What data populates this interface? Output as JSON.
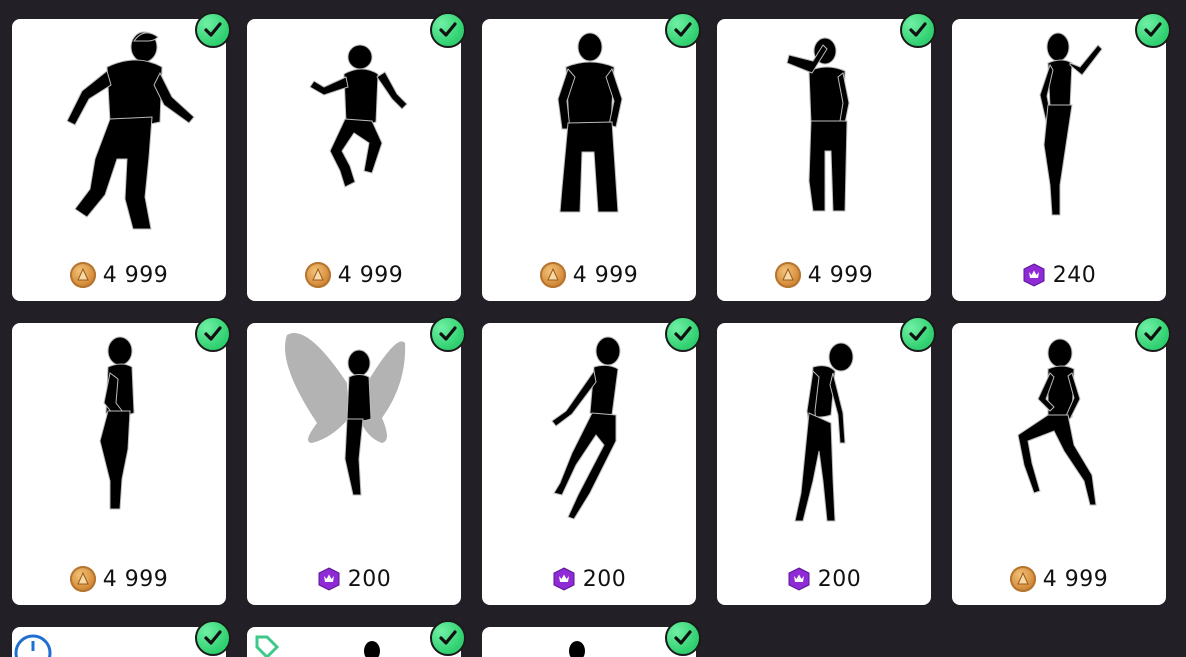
{
  "items": [
    {
      "price": "4 999",
      "currency": "coin",
      "owned": true,
      "pose": "jump-man"
    },
    {
      "price": "4 999",
      "currency": "coin",
      "owned": true,
      "pose": "leap-man"
    },
    {
      "price": "4 999",
      "currency": "coin",
      "owned": true,
      "pose": "stand-man"
    },
    {
      "price": "4 999",
      "currency": "coin",
      "owned": true,
      "pose": "salute-man"
    },
    {
      "price": "240",
      "currency": "crown",
      "owned": true,
      "pose": "wave-woman"
    },
    {
      "price": "4 999",
      "currency": "coin",
      "owned": true,
      "pose": "shy-woman"
    },
    {
      "price": "200",
      "currency": "crown",
      "owned": true,
      "pose": "fairy"
    },
    {
      "price": "200",
      "currency": "crown",
      "owned": true,
      "pose": "float-woman"
    },
    {
      "price": "200",
      "currency": "crown",
      "owned": true,
      "pose": "sad-woman"
    },
    {
      "price": "4 999",
      "currency": "coin",
      "owned": true,
      "pose": "run-woman"
    },
    {
      "price": "",
      "currency": "",
      "owned": true,
      "pose": "partial"
    },
    {
      "price": "",
      "currency": "",
      "owned": true,
      "pose": "partial"
    },
    {
      "price": "",
      "currency": "",
      "owned": true,
      "pose": "partial"
    }
  ],
  "colors": {
    "background": "#222026",
    "card": "#ffffff",
    "check": "#3ee07f",
    "coin": "#d8913f",
    "crown": "#8e2bd6"
  },
  "icons": {
    "owned": "checkmark-icon",
    "coin": "coin-icon",
    "crown": "crown-gem-icon"
  }
}
